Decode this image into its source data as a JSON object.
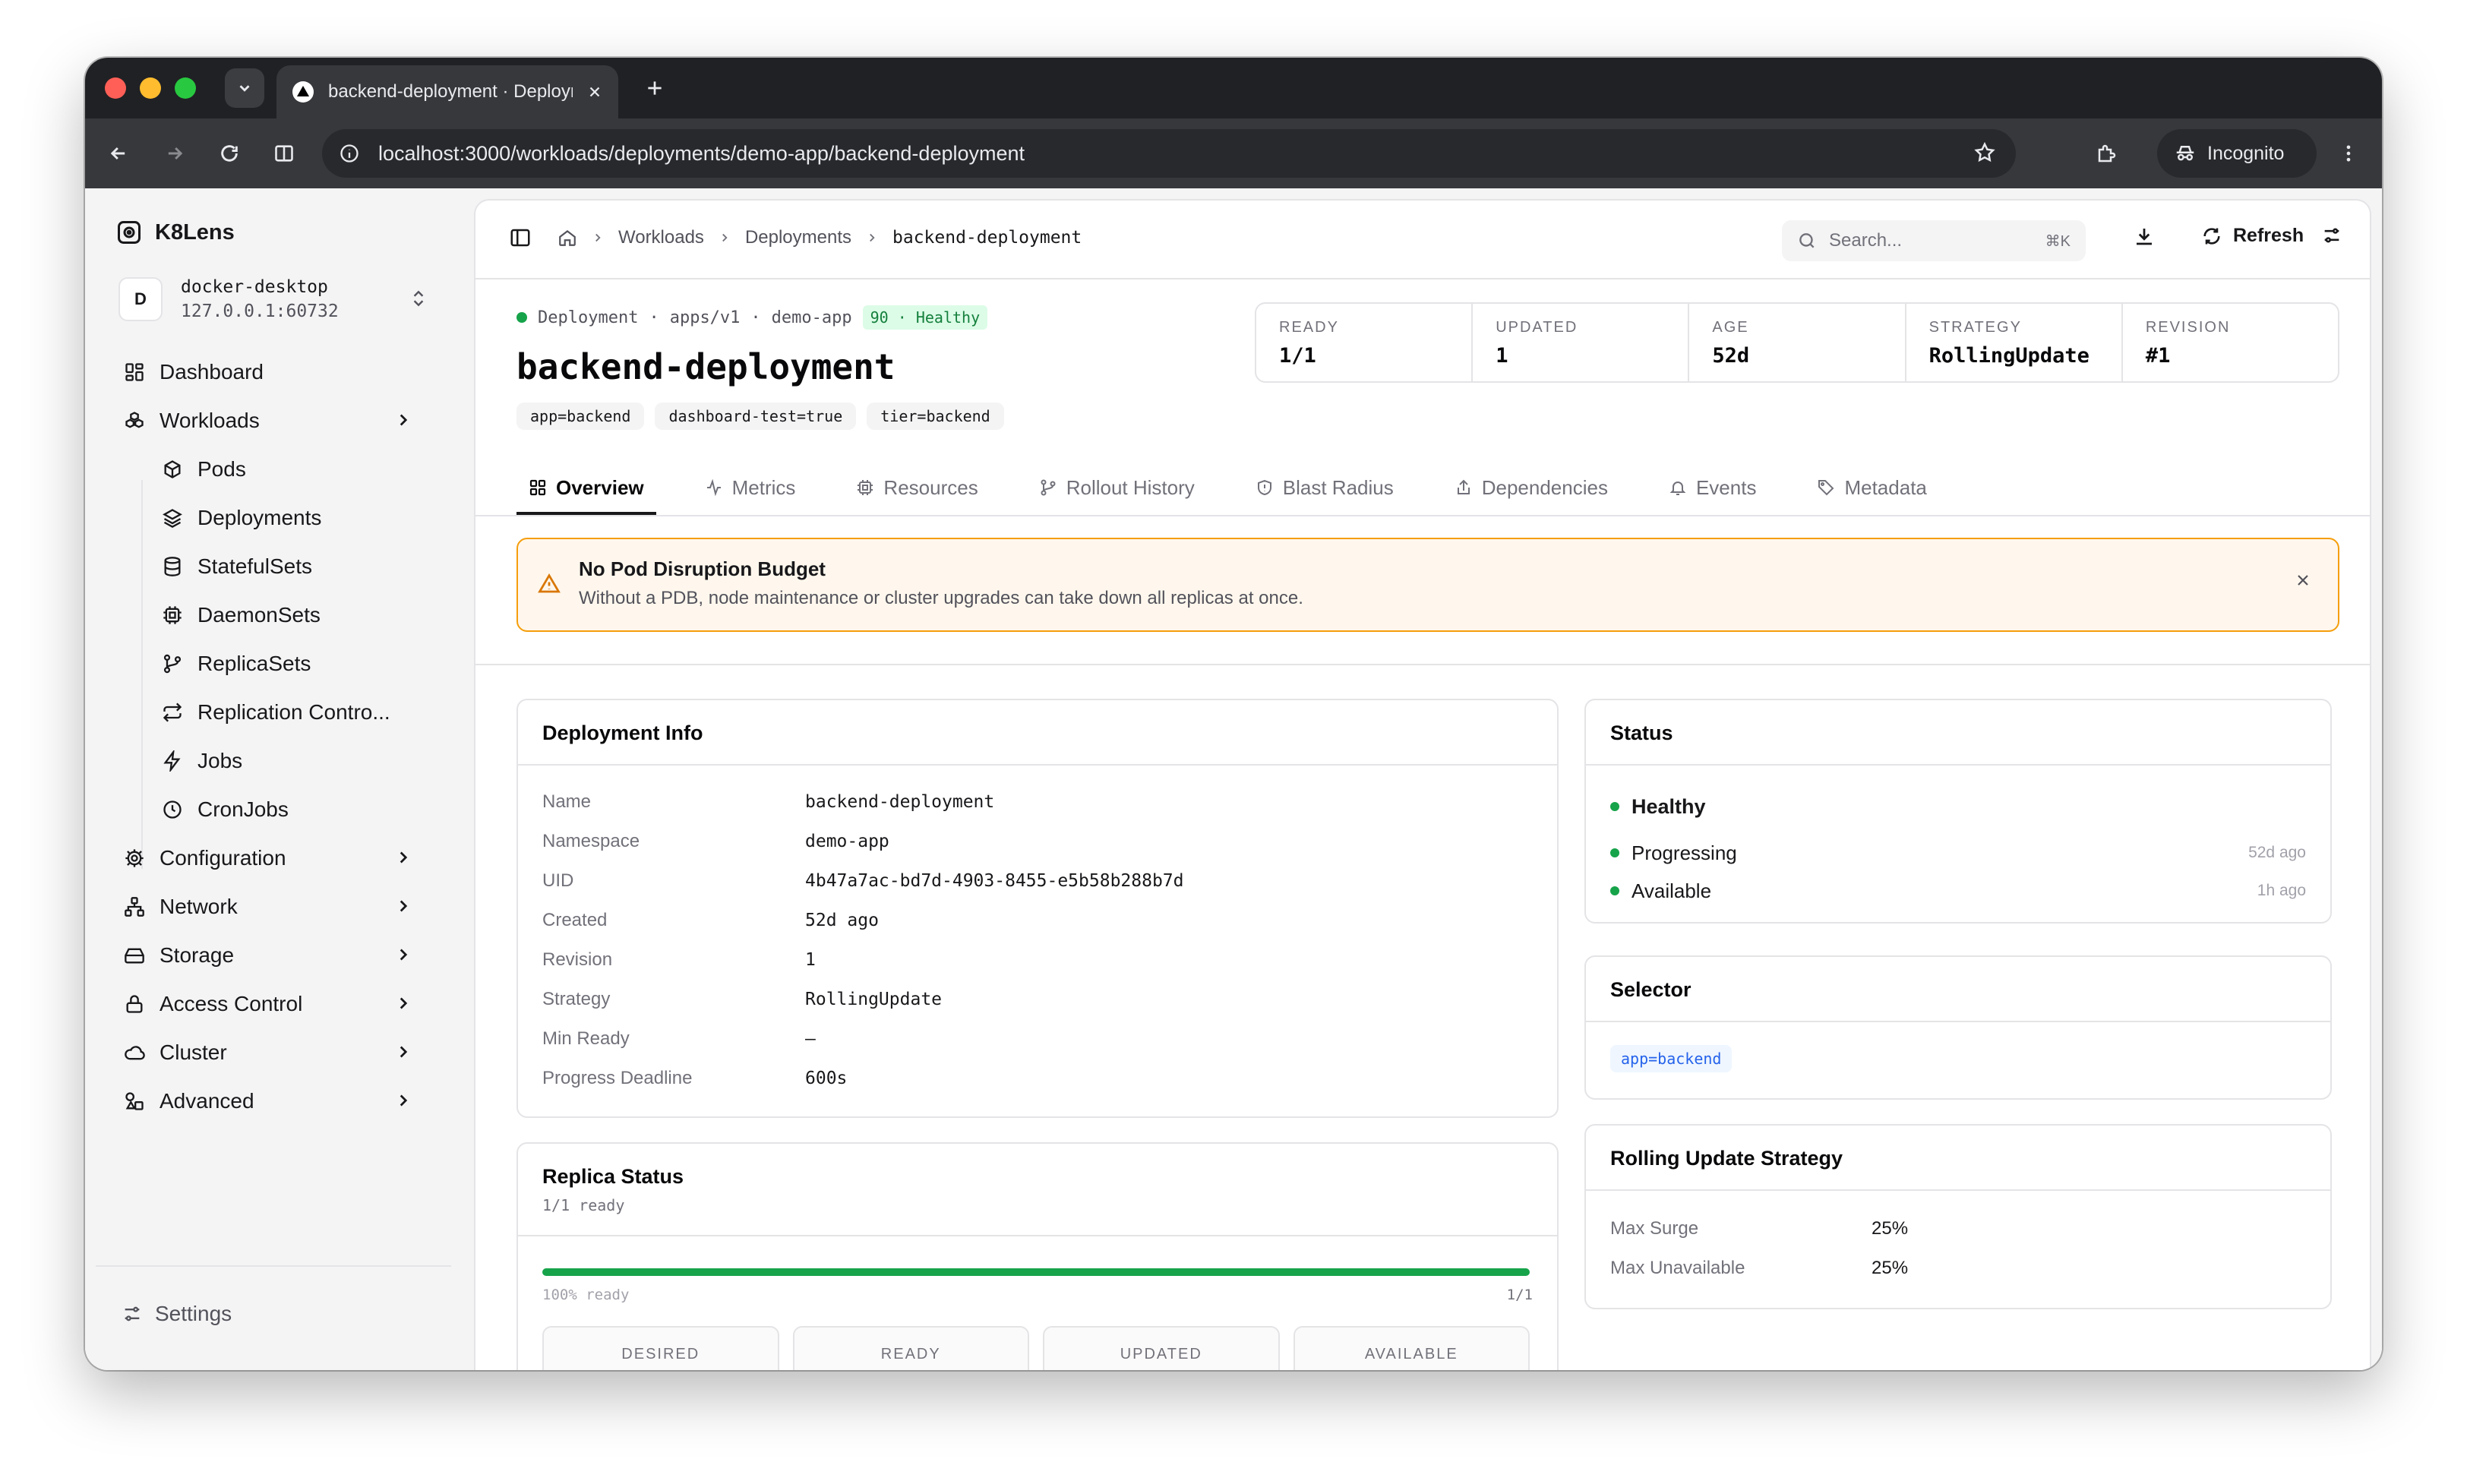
{
  "browser": {
    "tab_title": "backend-deployment · Deployment",
    "url": "localhost:3000/workloads/deployments/demo-app/backend-deployment",
    "incognito_label": "Incognito"
  },
  "sidebar": {
    "brand": "K8Lens",
    "cluster": {
      "initial": "D",
      "name": "docker-desktop",
      "address": "127.0.0.1:60732"
    },
    "items": [
      {
        "label": "Dashboard",
        "icon": "grid-icon"
      },
      {
        "label": "Workloads",
        "icon": "boxes-icon"
      },
      {
        "label": "Pods",
        "icon": "cube-icon"
      },
      {
        "label": "Deployments",
        "icon": "layers-icon"
      },
      {
        "label": "StatefulSets",
        "icon": "database-icon"
      },
      {
        "label": "DaemonSets",
        "icon": "cpu-icon"
      },
      {
        "label": "ReplicaSets",
        "icon": "git-branch-icon"
      },
      {
        "label": "Replication Contro...",
        "icon": "repeat-icon"
      },
      {
        "label": "Jobs",
        "icon": "zap-icon"
      },
      {
        "label": "CronJobs",
        "icon": "clock-icon"
      },
      {
        "label": "Configuration",
        "icon": "gear-icon"
      },
      {
        "label": "Network",
        "icon": "network-icon"
      },
      {
        "label": "Storage",
        "icon": "hard-drive-icon"
      },
      {
        "label": "Access Control",
        "icon": "lock-icon"
      },
      {
        "label": "Cluster",
        "icon": "cloud-icon"
      },
      {
        "label": "Advanced",
        "icon": "shapes-icon"
      }
    ],
    "settings_label": "Settings"
  },
  "topbar": {
    "breadcrumbs": [
      "Workloads",
      "Deployments",
      "backend-deployment"
    ],
    "search_placeholder": "Search...",
    "search_shortcut": "⌘K",
    "refresh_label": "Refresh"
  },
  "resource": {
    "kind": "Deployment",
    "api_version": "apps/v1",
    "namespace": "demo-app",
    "health_score": "90 · Healthy",
    "name": "backend-deployment",
    "labels": [
      "app=backend",
      "dashboard-test=true",
      "tier=backend"
    ]
  },
  "stats": [
    {
      "label": "READY",
      "value": "1/1"
    },
    {
      "label": "UPDATED",
      "value": "1"
    },
    {
      "label": "AGE",
      "value": "52d"
    },
    {
      "label": "STRATEGY",
      "value": "RollingUpdate"
    },
    {
      "label": "REVISION",
      "value": "#1"
    }
  ],
  "tabs": [
    {
      "label": "Overview",
      "icon": "grid-icon",
      "active": true
    },
    {
      "label": "Metrics",
      "icon": "activity-icon"
    },
    {
      "label": "Resources",
      "icon": "cpu-icon"
    },
    {
      "label": "Rollout History",
      "icon": "git-branch-icon"
    },
    {
      "label": "Blast Radius",
      "icon": "shield-icon"
    },
    {
      "label": "Dependencies",
      "icon": "share-icon"
    },
    {
      "label": "Events",
      "icon": "bell-icon"
    },
    {
      "label": "Metadata",
      "icon": "tag-icon"
    }
  ],
  "alert": {
    "title": "No Pod Disruption Budget",
    "message": "Without a PDB, node maintenance or cluster upgrades can take down all replicas at once.",
    "color": "#f59e0b"
  },
  "deployment_info": {
    "title": "Deployment Info",
    "rows": [
      {
        "key": "Name",
        "value": "backend-deployment"
      },
      {
        "key": "Namespace",
        "value": "demo-app"
      },
      {
        "key": "UID",
        "value": "4b47a7ac-bd7d-4903-8455-e5b58b288b7d"
      },
      {
        "key": "Created",
        "value": "52d ago"
      },
      {
        "key": "Revision",
        "value": "1"
      },
      {
        "key": "Strategy",
        "value": "RollingUpdate"
      },
      {
        "key": "Min Ready",
        "value": "—"
      },
      {
        "key": "Progress Deadline",
        "value": "600s"
      }
    ]
  },
  "status_card": {
    "title": "Status",
    "overall": "Healthy",
    "conditions": [
      {
        "label": "Progressing",
        "time": "52d ago"
      },
      {
        "label": "Available",
        "time": "1h ago"
      }
    ]
  },
  "selector_card": {
    "title": "Selector",
    "selector": "app=backend"
  },
  "rolling_update": {
    "title": "Rolling Update Strategy",
    "rows": [
      {
        "key": "Max Surge",
        "value": "25%"
      },
      {
        "key": "Max Unavailable",
        "value": "25%"
      }
    ]
  },
  "replica_status": {
    "title": "Replica Status",
    "subtitle": "1/1 ready",
    "progress_fraction": 1.0,
    "progress_left": "100% ready",
    "progress_right": "1/1",
    "boxes": [
      "DESIRED",
      "READY",
      "UPDATED",
      "AVAILABLE"
    ]
  },
  "colors": {
    "healthy": "#16a34a",
    "warning": "#f59e0b",
    "accent": "#2563eb"
  }
}
